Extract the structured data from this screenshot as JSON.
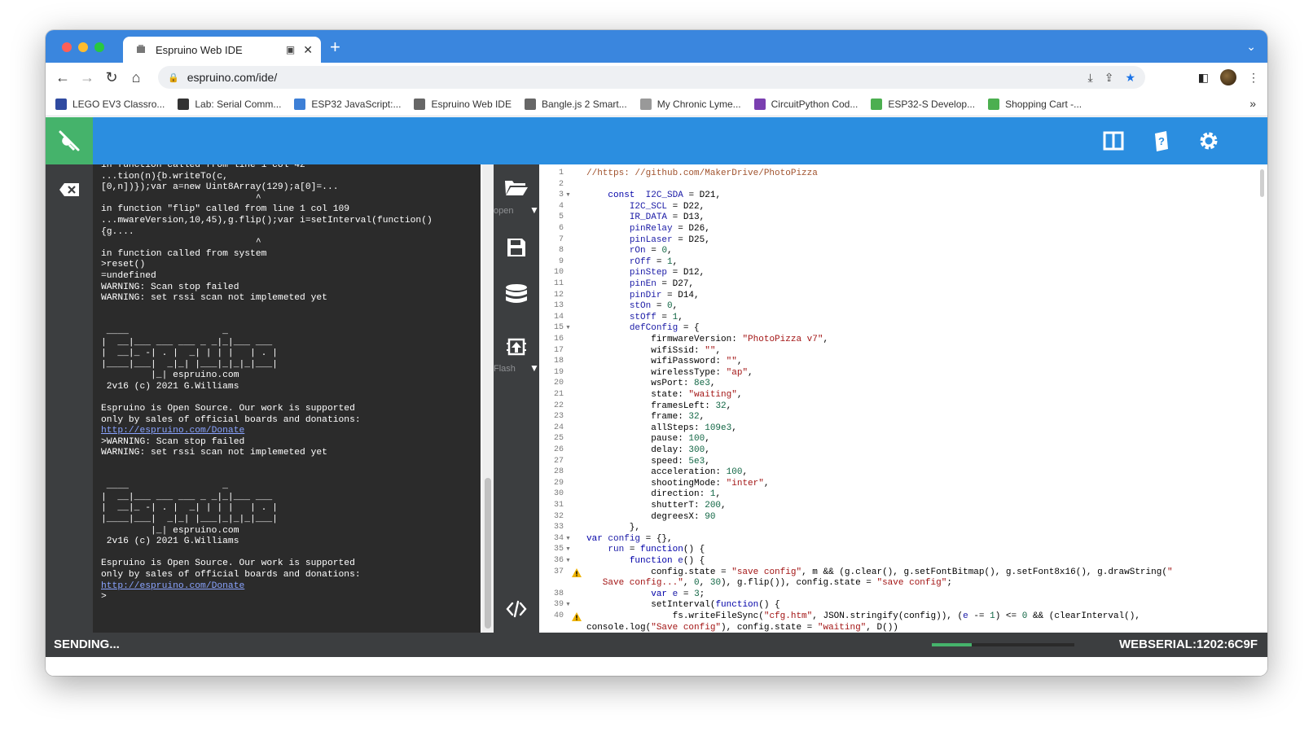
{
  "browser": {
    "tab_title": "Espruino Web IDE",
    "url": "espruino.com/ide/",
    "bookmarks": [
      {
        "label": "LEGO EV3 Classro...",
        "color": "#2f4aa0"
      },
      {
        "label": "Lab: Serial Comm...",
        "color": "#333333"
      },
      {
        "label": "ESP32 JavaScript:...",
        "color": "#3d7fd6"
      },
      {
        "label": "Espruino Web IDE",
        "color": "#666666"
      },
      {
        "label": "Bangle.js 2 Smart...",
        "color": "#666666"
      },
      {
        "label": "My Chronic Lyme...",
        "color": "#999999"
      },
      {
        "label": "CircuitPython Cod...",
        "color": "#7a3fb0"
      },
      {
        "label": "ESP32-S Develop...",
        "color": "#4caf50"
      },
      {
        "label": "Shopping Cart -...",
        "color": "#4caf50"
      }
    ],
    "bookmarks_overflow": "»"
  },
  "ide": {
    "colors": {
      "header": "#2b8ee0",
      "connect": "#45b36b",
      "panel": "#3c3e40",
      "terminal": "#2b2b2b"
    },
    "mid_toolbar": {
      "open_label": "open",
      "flash_label": "Flash"
    },
    "status_left": "SENDING...",
    "status_right": "WEBSERIAL:1202:6C9F",
    "progress": 0.28
  },
  "terminal": {
    "block1": "in function called from line 1 col 42\n...tion(n){b.writeTo(c,\n[0,n])});var a=new Uint8Array(129);a[0]=...\n                            ^\nin function \"flip\" called from line 1 col 109\n...mwareVersion,10,45),g.flip();var i=setInterval(function()\n{g....\n                            ^\nin function called from system\n>reset()\n=undefined\nWARNING: Scan stop failed\nWARNING: set rssi scan not implemeted yet\n\n\n ____                 _\n|  __|___ ___ ___ _ _|_|___ ___\n|  __|_ -| . |  _| | | |   | . |\n|____|___|  _|_| |___|_|_|_|___|\n         |_| espruino.com\n 2v16 (c) 2021 G.Williams\n\nEspruino is Open Source. Our work is supported\nonly by sales of official boards and donations:",
    "link1": "http://espruino.com/Donate",
    "block2": "\n>WARNING: Scan stop failed\nWARNING: set rssi scan not implemeted yet\n\n\n ____                 _\n|  __|___ ___ ___ _ _|_|___ ___\n|  __|_ -| . |  _| | | |   | . |\n|____|___|  _|_| |___|_|_|_|___|\n         |_| espruino.com\n 2v16 (c) 2021 G.Williams\n\nEspruino is Open Source. Our work is supported\nonly by sales of official boards and donations:",
    "link2": "http://espruino.com/Donate",
    "prompt": "\n>"
  },
  "editor": {
    "line_numbers": [
      "1",
      "2",
      "3",
      "4",
      "5",
      "6",
      "7",
      "8",
      "9",
      "10",
      "11",
      "12",
      "13",
      "14",
      "15",
      "16",
      "17",
      "18",
      "19",
      "20",
      "21",
      "22",
      "23",
      "24",
      "25",
      "26",
      "27",
      "28",
      "29",
      "30",
      "31",
      "32",
      "33",
      "34",
      "35",
      "36",
      "37",
      "",
      "38",
      "39",
      "40"
    ],
    "fold_lines": [
      "3",
      "15",
      "34",
      "35",
      "36",
      "39"
    ],
    "warning_lines": [
      "37",
      "40"
    ],
    "lines": [
      [
        [
          "cmt",
          "//https: //github.com/MakerDrive/PhotoPizza"
        ]
      ],
      [
        [
          "",
          ""
        ]
      ],
      [
        [
          "",
          "    "
        ],
        [
          "kw",
          "const"
        ],
        [
          "",
          "  "
        ],
        [
          "vr",
          "I2C_SDA"
        ],
        [
          "",
          " = D21,"
        ]
      ],
      [
        [
          "",
          "        "
        ],
        [
          "vr",
          "I2C_SCL"
        ],
        [
          "",
          " = D22,"
        ]
      ],
      [
        [
          "",
          "        "
        ],
        [
          "vr",
          "IR_DATA"
        ],
        [
          "",
          " = D13,"
        ]
      ],
      [
        [
          "",
          "        "
        ],
        [
          "vr",
          "pinRelay"
        ],
        [
          "",
          " = D26,"
        ]
      ],
      [
        [
          "",
          "        "
        ],
        [
          "vr",
          "pinLaser"
        ],
        [
          "",
          " = D25,"
        ]
      ],
      [
        [
          "",
          "        "
        ],
        [
          "vr",
          "rOn"
        ],
        [
          "",
          " = "
        ],
        [
          "nm",
          "0"
        ],
        [
          ",",
          ""
        ]
      ],
      [
        [
          "",
          "        "
        ],
        [
          "vr",
          "rOff"
        ],
        [
          "",
          " = "
        ],
        [
          "nm",
          "1"
        ],
        [
          ",",
          ""
        ]
      ],
      [
        [
          "",
          "        "
        ],
        [
          "vr",
          "pinStep"
        ],
        [
          "",
          " = D12,"
        ]
      ],
      [
        [
          "",
          "        "
        ],
        [
          "vr",
          "pinEn"
        ],
        [
          "",
          " = D27,"
        ]
      ],
      [
        [
          "",
          "        "
        ],
        [
          "vr",
          "pinDir"
        ],
        [
          "",
          " = D14,"
        ]
      ],
      [
        [
          "",
          "        "
        ],
        [
          "vr",
          "stOn"
        ],
        [
          "",
          " = "
        ],
        [
          "nm",
          "0"
        ],
        [
          ",",
          ""
        ]
      ],
      [
        [
          "",
          "        "
        ],
        [
          "vr",
          "stOff"
        ],
        [
          "",
          " = "
        ],
        [
          "nm",
          "1"
        ],
        [
          ",",
          ""
        ]
      ],
      [
        [
          "",
          "        "
        ],
        [
          "vr",
          "defConfig"
        ],
        [
          "",
          " = {"
        ]
      ],
      [
        [
          "",
          "            firmwareVersion: "
        ],
        [
          "st",
          "\"PhotoPizza v7\""
        ],
        [
          "",
          ","
        ]
      ],
      [
        [
          "",
          "            wifiSsid: "
        ],
        [
          "st",
          "\"\""
        ],
        [
          "",
          ","
        ]
      ],
      [
        [
          "",
          "            wifiPassword: "
        ],
        [
          "st",
          "\"\""
        ],
        [
          "",
          ","
        ]
      ],
      [
        [
          "",
          "            wirelessType: "
        ],
        [
          "st",
          "\"ap\""
        ],
        [
          "",
          ","
        ]
      ],
      [
        [
          "",
          "            wsPort: "
        ],
        [
          "nm",
          "8e3"
        ],
        [
          "",
          ","
        ]
      ],
      [
        [
          "",
          "            state: "
        ],
        [
          "st",
          "\"waiting\""
        ],
        [
          "",
          ","
        ]
      ],
      [
        [
          "",
          "            framesLeft: "
        ],
        [
          "nm",
          "32"
        ],
        [
          "",
          ","
        ]
      ],
      [
        [
          "",
          "            frame: "
        ],
        [
          "nm",
          "32"
        ],
        [
          "",
          ","
        ]
      ],
      [
        [
          "",
          "            allSteps: "
        ],
        [
          "nm",
          "109e3"
        ],
        [
          "",
          ","
        ]
      ],
      [
        [
          "",
          "            pause: "
        ],
        [
          "nm",
          "100"
        ],
        [
          "",
          ","
        ]
      ],
      [
        [
          "",
          "            delay: "
        ],
        [
          "nm",
          "300"
        ],
        [
          "",
          ","
        ]
      ],
      [
        [
          "",
          "            speed: "
        ],
        [
          "nm",
          "5e3"
        ],
        [
          "",
          ","
        ]
      ],
      [
        [
          "",
          "            acceleration: "
        ],
        [
          "nm",
          "100"
        ],
        [
          "",
          ","
        ]
      ],
      [
        [
          "",
          "            shootingMode: "
        ],
        [
          "st",
          "\"inter\""
        ],
        [
          "",
          ","
        ]
      ],
      [
        [
          "",
          "            direction: "
        ],
        [
          "nm",
          "1"
        ],
        [
          "",
          ","
        ]
      ],
      [
        [
          "",
          "            shutterT: "
        ],
        [
          "nm",
          "200"
        ],
        [
          "",
          ","
        ]
      ],
      [
        [
          "",
          "            degreesX: "
        ],
        [
          "nm",
          "90"
        ]
      ],
      [
        [
          "",
          "        },"
        ]
      ],
      [
        [
          "kw",
          "var"
        ],
        [
          "",
          " "
        ],
        [
          "vr",
          "config"
        ],
        [
          "",
          " = {},"
        ]
      ],
      [
        [
          "",
          "    "
        ],
        [
          "vr",
          "run"
        ],
        [
          "",
          " = "
        ],
        [
          "kw",
          "function"
        ],
        [
          "",
          "() {"
        ]
      ],
      [
        [
          "",
          "        "
        ],
        [
          "kw",
          "function"
        ],
        [
          "",
          " "
        ],
        [
          "vr",
          "e"
        ],
        [
          "",
          "() {"
        ]
      ],
      [
        [
          "",
          "            config.state = "
        ],
        [
          "st",
          "\"save config\""
        ],
        [
          "",
          ", m && (g.clear(), g.setFontBitmap(), g.setFont8x16(), g.drawString("
        ],
        [
          "st",
          "\""
        ]
      ],
      [
        [
          "st",
          "   Save config...\""
        ],
        [
          "",
          ", "
        ],
        [
          "nm",
          "0"
        ],
        [
          "",
          ", "
        ],
        [
          "nm",
          "30"
        ],
        [
          "",
          "), g.flip()), config.state = "
        ],
        [
          "st",
          "\"save config\""
        ],
        [
          "",
          ";"
        ]
      ],
      [
        [
          "",
          "            "
        ],
        [
          "kw",
          "var"
        ],
        [
          "",
          " "
        ],
        [
          "vr",
          "e"
        ],
        [
          "",
          " = "
        ],
        [
          "nm",
          "3"
        ],
        [
          "",
          ";"
        ]
      ],
      [
        [
          "",
          "            setInterval("
        ],
        [
          "kw",
          "function"
        ],
        [
          "",
          "() {"
        ]
      ],
      [
        [
          "",
          "                fs.writeFileSync("
        ],
        [
          "st",
          "\"cfg.htm\""
        ],
        [
          "",
          ", JSON.stringify(config)), ("
        ],
        [
          "vr",
          "e"
        ],
        [
          "",
          " -= "
        ],
        [
          "nm",
          "1"
        ],
        [
          "",
          ") <= "
        ],
        [
          "nm",
          "0"
        ],
        [
          "",
          " && (clearInterval(),"
        ]
      ],
      [
        [
          "",
          "console.log("
        ],
        [
          "st",
          "\"Save config\""
        ],
        [
          "",
          "), config.state = "
        ],
        [
          "st",
          "\"waiting\""
        ],
        [
          "",
          ", D())"
        ]
      ]
    ]
  }
}
